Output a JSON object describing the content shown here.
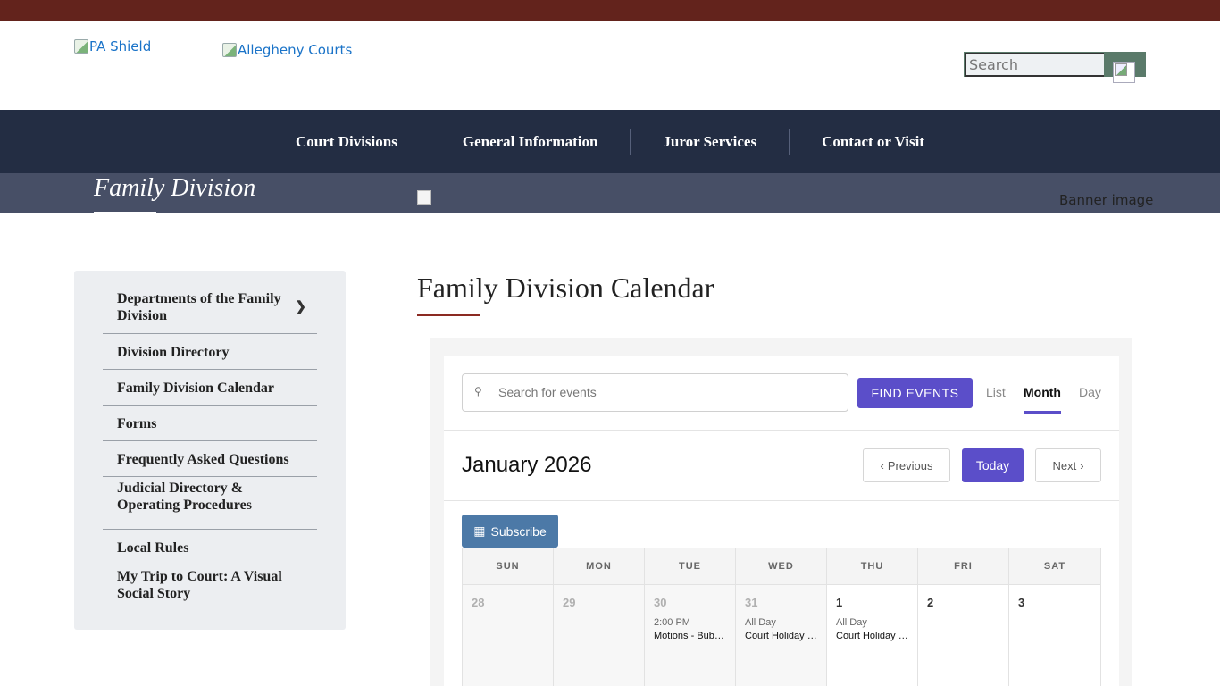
{
  "header": {
    "shield_alt": "PA Shield",
    "courts_alt": "Allegheny Courts",
    "search_placeholder": "Search"
  },
  "nav": {
    "items": [
      "Court Divisions",
      "General Information",
      "Juror Services",
      "Contact or Visit"
    ]
  },
  "banner": {
    "title": "Family Division",
    "image_alt": "Banner image"
  },
  "sidebar": {
    "items": [
      {
        "label": "Departments of the Family Division",
        "has_submenu": true
      },
      {
        "label": "Division Directory"
      },
      {
        "label": "Family Division Calendar"
      },
      {
        "label": "Forms"
      },
      {
        "label": "Frequently Asked Questions"
      },
      {
        "label": "Judicial Directory & Operating Procedures"
      },
      {
        "label": "Local Rules"
      },
      {
        "label": "My Trip to Court: A Visual Social Story"
      }
    ]
  },
  "page": {
    "title": "Family Division Calendar"
  },
  "calendar": {
    "search_placeholder": "Search for events",
    "find_label": "FIND EVENTS",
    "views": [
      "List",
      "Month",
      "Day"
    ],
    "active_view": "Month",
    "month_label": "January 2026",
    "prev_label": "Previous",
    "today_label": "Today",
    "next_label": "Next",
    "subscribe_label": "Subscribe",
    "weekdays": [
      "SUN",
      "MON",
      "TUE",
      "WED",
      "THU",
      "FRI",
      "SAT"
    ],
    "first_week": [
      {
        "num": "28",
        "other": true
      },
      {
        "num": "29",
        "other": true
      },
      {
        "num": "30",
        "other": true,
        "time": "2:00 PM",
        "title": "Motions - Bubash"
      },
      {
        "num": "31",
        "other": true,
        "time": "All Day",
        "title": "Court Holiday - New Year's Eve"
      },
      {
        "num": "1",
        "other": false,
        "time": "All Day",
        "title": "Court Holiday - New Year's Day"
      },
      {
        "num": "2",
        "other": false
      },
      {
        "num": "3",
        "other": false
      }
    ],
    "accent_color": "#5b4ec9",
    "subscribe_color": "#4c79a7"
  }
}
